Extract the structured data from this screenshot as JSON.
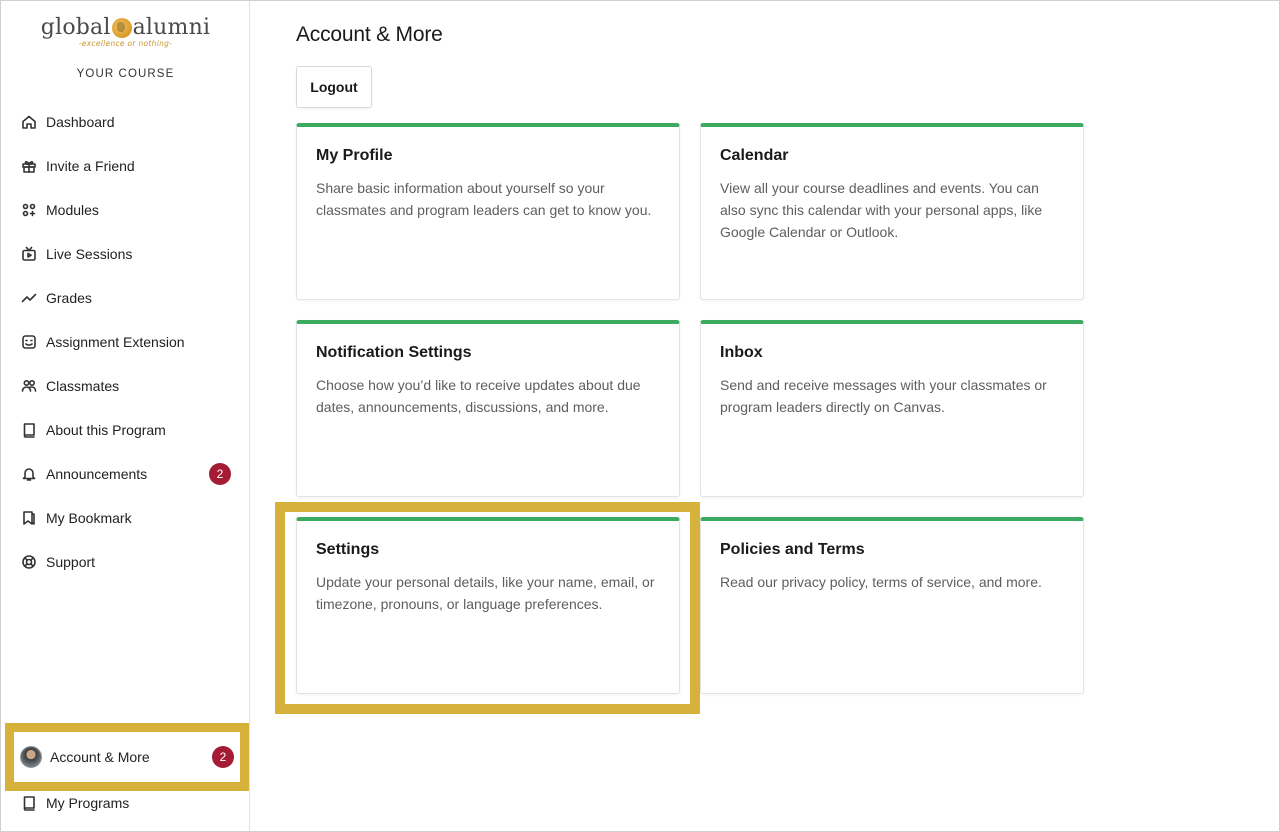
{
  "sidebar": {
    "logo": {
      "left": "global",
      "right": "alumni",
      "tagline": "-excellence or nothing-"
    },
    "course_label": "YOUR COURSE",
    "items": [
      {
        "label": "Dashboard",
        "icon": "home-icon"
      },
      {
        "label": "Invite a Friend",
        "icon": "gift-icon"
      },
      {
        "label": "Modules",
        "icon": "modules-icon"
      },
      {
        "label": "Live Sessions",
        "icon": "tv-icon"
      },
      {
        "label": "Grades",
        "icon": "trend-icon"
      },
      {
        "label": "Assignment Extension",
        "icon": "extension-icon"
      },
      {
        "label": "Classmates",
        "icon": "people-icon"
      },
      {
        "label": "About this Program",
        "icon": "book-icon"
      },
      {
        "label": "Announcements",
        "icon": "bell-icon",
        "badge": "2"
      },
      {
        "label": "My Bookmark",
        "icon": "bookmark-icon"
      },
      {
        "label": "Support",
        "icon": "lifebuoy-icon"
      }
    ],
    "account": {
      "label": "Account & More",
      "badge": "2"
    },
    "programs": {
      "label": "My Programs"
    }
  },
  "main": {
    "title": "Account & More",
    "logout_label": "Logout",
    "cards": [
      {
        "title": "My Profile",
        "desc": "Share basic information about yourself so your classmates and program leaders can get to know you."
      },
      {
        "title": "Calendar",
        "desc": "View all your course deadlines and events. You can also sync this calendar with your personal apps, like Google Calendar or Outlook."
      },
      {
        "title": "Notification Settings",
        "desc": "Choose how you’d like to receive updates about due dates, announcements, discussions, and more."
      },
      {
        "title": "Inbox",
        "desc": "Send and receive messages with your classmates or program leaders directly on Canvas."
      },
      {
        "title": "Settings",
        "desc": "Update your personal details, like your name, email, or timezone, pronouns, or language preferences."
      },
      {
        "title": "Policies and Terms",
        "desc": "Read our privacy policy, terms of service, and more."
      }
    ]
  },
  "colors": {
    "accent_green": "#3daa62",
    "highlight": "#d6b13c",
    "badge": "#a31c34"
  }
}
